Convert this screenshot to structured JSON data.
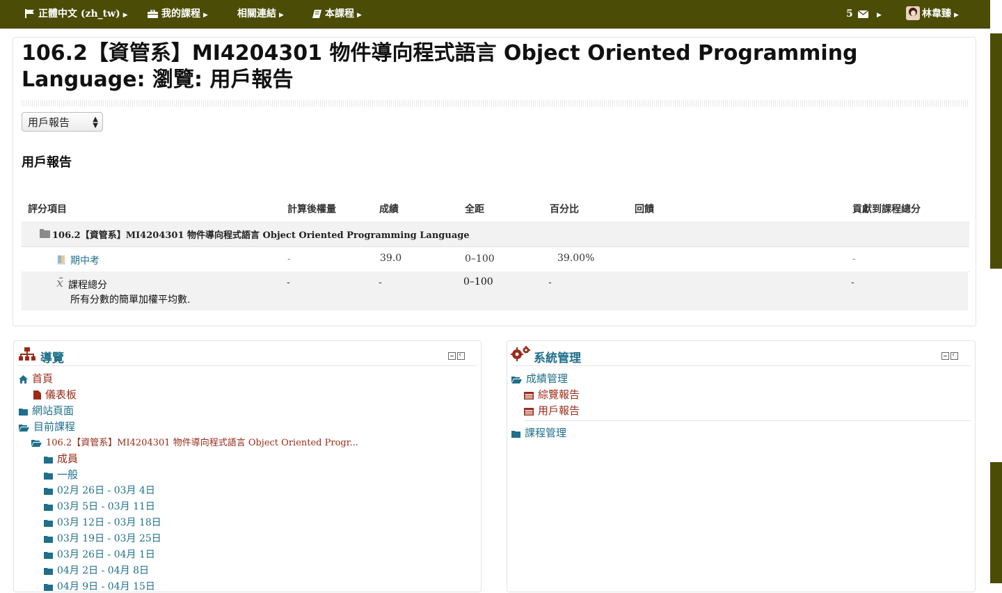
{
  "navbar": {
    "language": "正體中文 (zh_tw)",
    "my_courses": "我的課程",
    "related_links": "相關連結",
    "this_course": "本課程",
    "message_count": "5",
    "user_name": "林韋臻"
  },
  "page": {
    "title": "106.2【資管系】MI4204301 物件導向程式語言 Object Oriented Programming Language: 瀏覽: 用戶報告",
    "report_select": "用戶報告",
    "report_heading": "用戶報告"
  },
  "grade_table": {
    "headers": [
      "評分項目",
      "計算後權量",
      "成績",
      "全距",
      "百分比",
      "回饋",
      "貢獻到課程總分"
    ],
    "course_category": "106.2【資管系】MI4204301 物件導向程式語言 Object Oriented Programming Language",
    "item": {
      "name": "期中考",
      "weight": "-",
      "grade": "39.0",
      "range": "0–100",
      "percentage": "39.00%",
      "feedback": "",
      "contribution": "-"
    },
    "total": {
      "name": "課程總分",
      "description": "所有分數的簡單加權平均數.",
      "weight": "-",
      "grade": "-",
      "range": "0–100",
      "percentage": "-",
      "contribution": "-"
    }
  },
  "navigation_block": {
    "title": "導覽",
    "home": "首頁",
    "dashboard": "儀表板",
    "site_pages": "網站頁面",
    "current_course": "目前課程",
    "course_name": "106.2【資管系】MI4204301 物件導向程式語言 Object Oriented Progr...",
    "participants": "成員",
    "general": "一般",
    "weeks": [
      "02月 26日 - 03月 4日",
      "03月 5日 - 03月 11日",
      "03月 12日 - 03月 18日",
      "03月 19日 - 03月 25日",
      "03月 26日 - 04月 1日",
      "04月 2日 - 04月 8日",
      "04月 9日 - 04月 15日"
    ]
  },
  "admin_block": {
    "title": "系統管理",
    "grade_admin": "成績管理",
    "overview_report": "綜覽報告",
    "user_report": "用戶報告",
    "course_admin": "課程管理"
  },
  "colors": {
    "navbar": "#4b4c05",
    "link": "#1f6f8b",
    "active_link": "#9a2a18"
  }
}
